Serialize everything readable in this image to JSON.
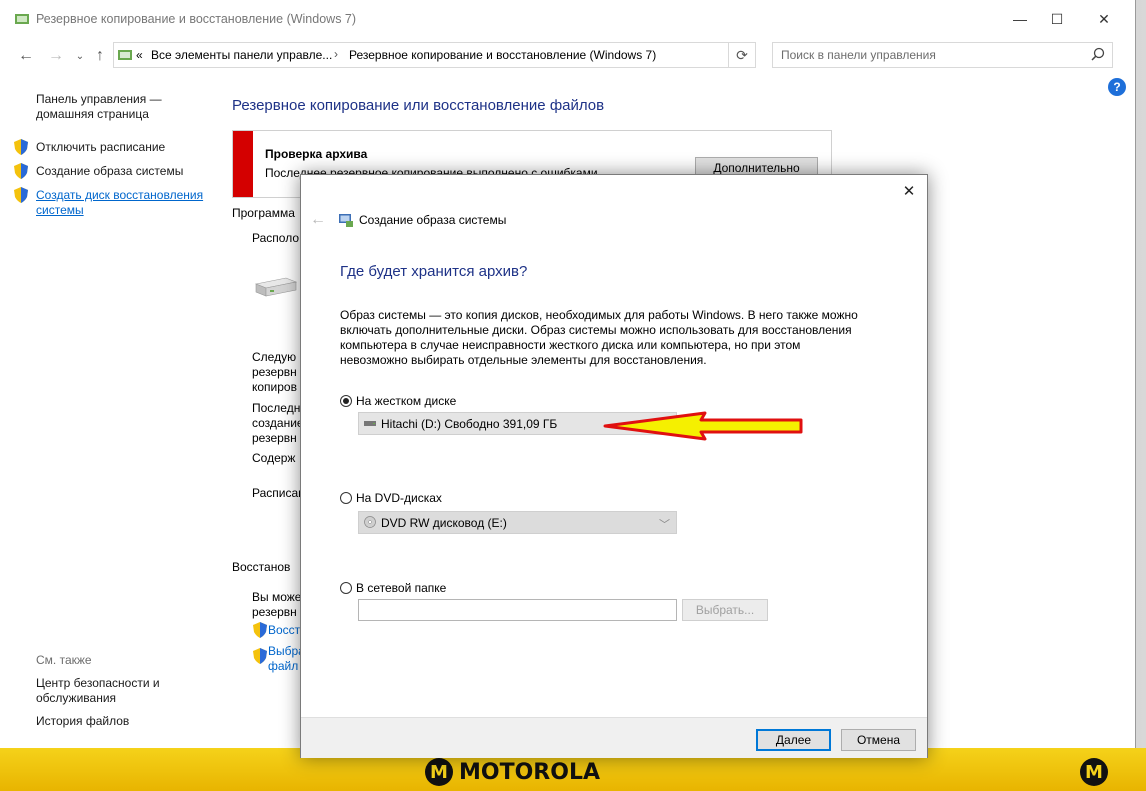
{
  "window": {
    "title": "Резервное копирование и восстановление (Windows 7)",
    "minimize_glyph": "—",
    "maximize_glyph": "☐",
    "close_glyph": "✕"
  },
  "address_bar": {
    "crumb_prefix": "«",
    "crumbs": [
      "Все элементы панели управле...",
      "Резервное копирование и восстановление (Windows 7)"
    ],
    "separator": "›"
  },
  "search": {
    "placeholder": "Поиск в панели управления"
  },
  "sidebar": {
    "home_link": "Панель управления —\nдомашняя страница",
    "items": [
      {
        "label": "Отключить расписание",
        "shield": true
      },
      {
        "label": "Создание образа системы",
        "shield": true
      },
      {
        "label": "Создать диск восстановления\nсистемы",
        "shield": true
      }
    ],
    "see_also_title": "См. также",
    "see_also": [
      "Центр безопасности и\nобслуживания",
      "История файлов"
    ]
  },
  "main": {
    "heading": "Резервное копирование или восстановление файлов",
    "alert": {
      "title": "Проверка архива",
      "text": "Последнее резервное копирование выполнено с ошибками",
      "button": "Дополнительно"
    },
    "partial_texts": {
      "program": "Программа",
      "location": "Располо",
      "next": "Следую",
      "next2": "резервн",
      "next3": "копиров",
      "last": "Последн",
      "last2": "создание",
      "last3": "резервн",
      "contents": "Содерж",
      "schedule": "Расписан",
      "restore": "Восстанов",
      "can": "Вы може",
      "can2": "резервн",
      "restore_link": "Восст",
      "select_link": "Выбра",
      "select_link2": "файл"
    }
  },
  "dialog": {
    "title": "Создание образа системы",
    "close_glyph": "✕",
    "back_glyph": "←",
    "heading": "Где будет хранится архив?",
    "description": "Образ системы — это копия дисков, необходимых для работы Windows. В него также можно включать дополнительные диски. Образ системы можно использовать для восстановления компьютера в случае неисправности жесткого диска или компьютера, но при этом невозможно выбирать отдельные элементы для восстановления.",
    "options": {
      "hard_disk": {
        "label": "На жестком диске",
        "selected": true,
        "value": "Hitachi (D:)  Свободно 391,09 ГБ"
      },
      "dvd": {
        "label": "На DVD-дисках",
        "selected": false,
        "value": "DVD RW дисковод (E:)"
      },
      "network": {
        "label": "В сетевой папке",
        "selected": false,
        "value": "",
        "browse": "Выбрать..."
      }
    },
    "buttons": {
      "next": "Далее",
      "cancel": "Отмена"
    }
  },
  "desktop": {
    "brand": "MOTOROLA",
    "brand_badge": "M"
  },
  "colors": {
    "accent": "#0078d7",
    "heading": "#1e3287",
    "alert": "#d40000",
    "link": "#0066cc"
  }
}
